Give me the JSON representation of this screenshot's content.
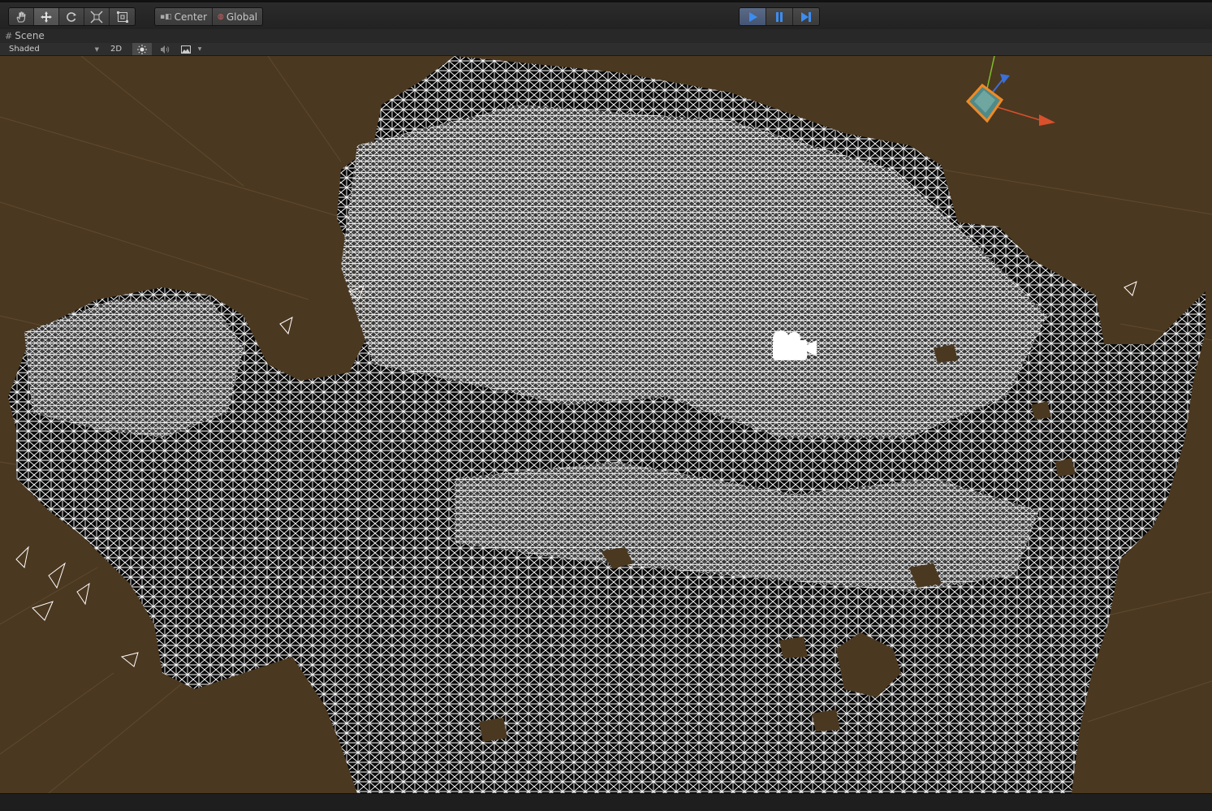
{
  "toolbar": {
    "transform_tools": [
      {
        "name": "hand-tool",
        "icon": "hand-icon"
      },
      {
        "name": "move-tool",
        "icon": "move-arrows-icon",
        "active": true
      },
      {
        "name": "rotate-tool",
        "icon": "rotate-icon"
      },
      {
        "name": "scale-tool",
        "icon": "scale-icon"
      },
      {
        "name": "rect-tool",
        "icon": "rect-transform-icon"
      }
    ],
    "pivot_mode_label": "Center",
    "pivot_rotation_label": "Global",
    "playback": {
      "play_active": true,
      "play_icon": "play-icon",
      "pause_icon": "pause-icon",
      "step_icon": "step-icon"
    }
  },
  "scene_tab": {
    "label": "Scene",
    "icon": "grid-icon"
  },
  "scene_controls": {
    "draw_mode": "Shaded",
    "two_d_label": "2D",
    "lighting_icon": "sun-icon",
    "audio_icon": "speaker-icon",
    "effects_icon": "image-icon"
  },
  "viewport": {
    "background_color": "#4b3820",
    "mesh_fill_color": "#080808",
    "mesh_wire_color": "#ffffff",
    "camera_gizmo_icon": "camera-icon",
    "orientation_gizmo": {
      "x_color": "#d9512c",
      "y_color": "#7fbf2a",
      "z_color": "#3b6fd9",
      "selection_color": "#f08a24"
    }
  }
}
